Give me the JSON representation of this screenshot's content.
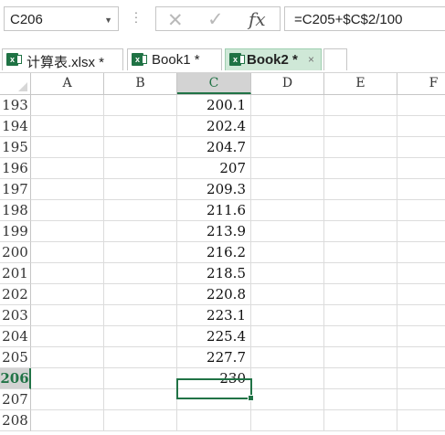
{
  "formula_bar": {
    "name_box": "C206",
    "formula": "=C205+$C$2/100",
    "cancel_icon": "x-icon",
    "enter_icon": "check-icon",
    "fx_label": "fx"
  },
  "workbook_tabs": [
    {
      "label": "计算表.xlsx *",
      "active": false
    },
    {
      "label": "Book1 *",
      "active": false
    },
    {
      "label": "Book2 *",
      "active": true,
      "close": "×"
    }
  ],
  "columns": [
    "A",
    "B",
    "C",
    "D",
    "E",
    "F"
  ],
  "selected_column": "C",
  "rows": [
    {
      "num": "193",
      "c": "200.1"
    },
    {
      "num": "194",
      "c": "202.4"
    },
    {
      "num": "195",
      "c": "204.7"
    },
    {
      "num": "196",
      "c": "207"
    },
    {
      "num": "197",
      "c": "209.3"
    },
    {
      "num": "198",
      "c": "211.6"
    },
    {
      "num": "199",
      "c": "213.9"
    },
    {
      "num": "200",
      "c": "216.2"
    },
    {
      "num": "201",
      "c": "218.5"
    },
    {
      "num": "202",
      "c": "220.8"
    },
    {
      "num": "203",
      "c": "223.1"
    },
    {
      "num": "204",
      "c": "225.4"
    },
    {
      "num": "205",
      "c": "227.7"
    },
    {
      "num": "206",
      "c": "230",
      "selected": true
    },
    {
      "num": "207",
      "c": ""
    },
    {
      "num": "208",
      "c": ""
    }
  ],
  "colors": {
    "accent": "#217346",
    "active_tab": "#cfe8d7"
  }
}
